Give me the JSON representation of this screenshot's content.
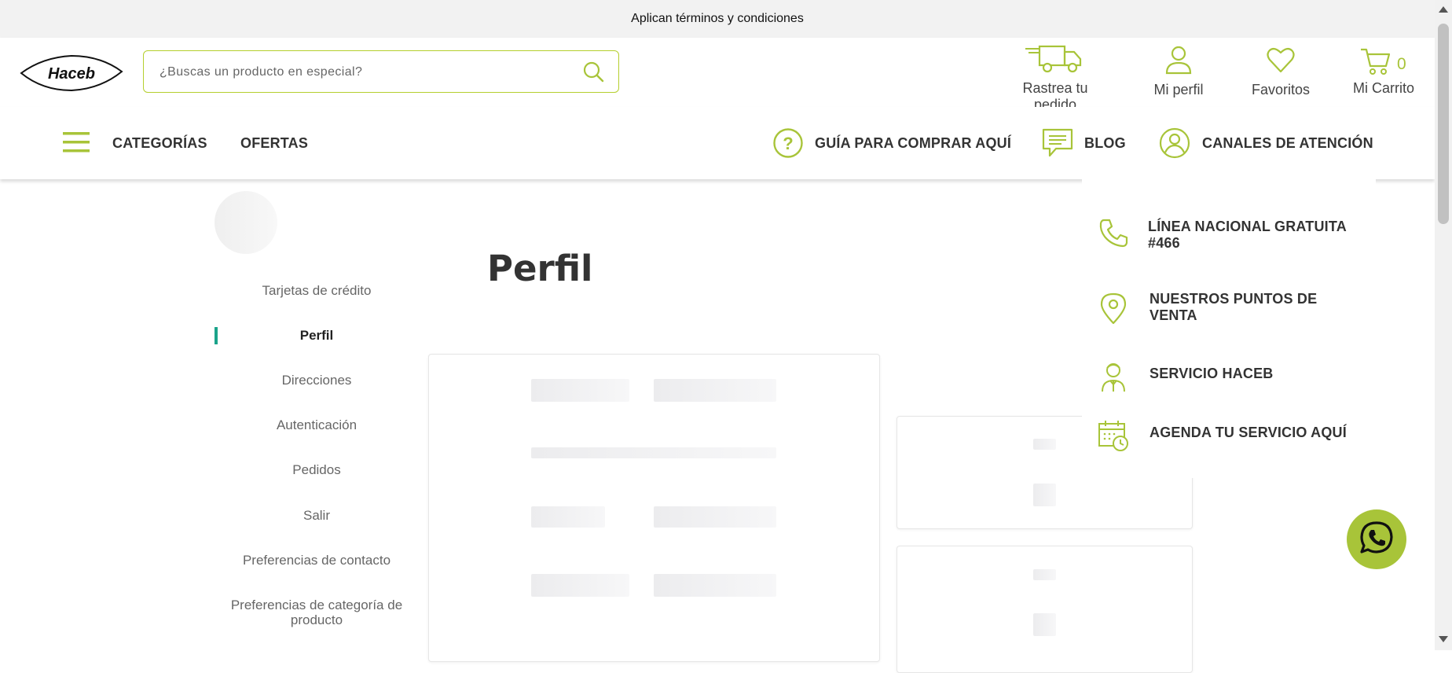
{
  "topbar": {
    "text": "Aplican términos y condiciones"
  },
  "header": {
    "logo_text": "Haceb",
    "search_placeholder": "¿Buscas un producto en especial?",
    "track_label": "Rastrea tu pedido",
    "profile_label": "Mi perfil",
    "favorites_label": "Favoritos",
    "cart_label": "Mi Carrito",
    "cart_count": "0"
  },
  "nav": {
    "categories": "CATEGORÍAS",
    "offers": "OFERTAS",
    "guide": "GUÍA PARA COMPRAR AQUÍ",
    "blog": "BLOG",
    "channels": "CANALES DE ATENCIÓN"
  },
  "sidebar": {
    "items": [
      {
        "label": "Tarjetas de crédito"
      },
      {
        "label": "Perfil"
      },
      {
        "label": "Direcciones"
      },
      {
        "label": "Autenticación"
      },
      {
        "label": "Pedidos"
      },
      {
        "label": "Salir"
      },
      {
        "label": "Preferencias de contacto"
      },
      {
        "label": "Preferencias de categoría de producto"
      }
    ],
    "active_index": 1
  },
  "main": {
    "title": "Perfil"
  },
  "channels_menu": {
    "items": [
      {
        "label": "LÍNEA NACIONAL GRATUITA #466",
        "icon": "phone-icon"
      },
      {
        "label": "NUESTROS PUNTOS DE VENTA",
        "icon": "location-pin-icon"
      },
      {
        "label": "SERVICIO HACEB",
        "icon": "technician-icon"
      },
      {
        "label": "AGENDA TU SERVICIO AQUÍ",
        "icon": "calendar-clock-icon"
      }
    ]
  },
  "colors": {
    "accent": "#a8c439",
    "active_marker": "#1aa38a",
    "topbar_bg": "#f2f2f2"
  }
}
